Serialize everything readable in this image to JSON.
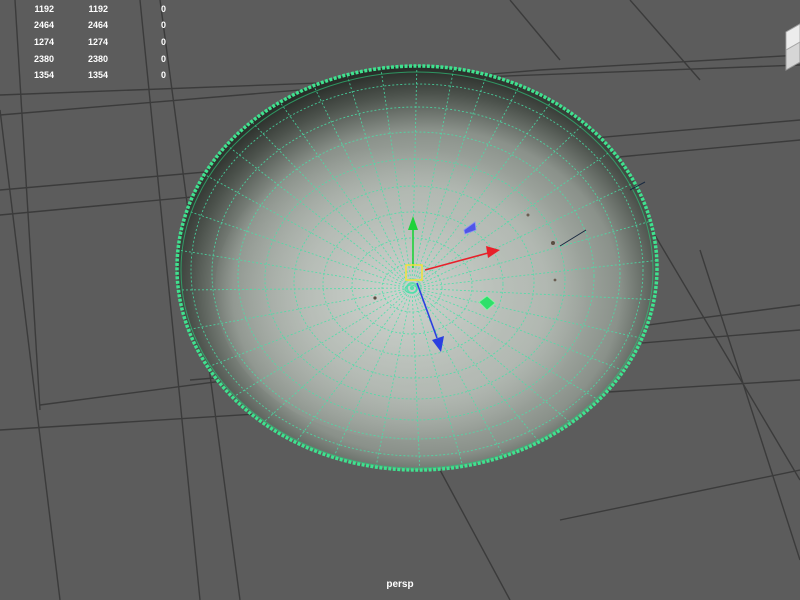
{
  "viewport": {
    "camera_label": "persp",
    "background_color": "#5c5c5c",
    "grid_color": "#3a3a3a",
    "wireframe_color": "#48e0a8",
    "selection_outline_color": "#3fe28f"
  },
  "hud_stats": {
    "rows": [
      {
        "c1": "1192",
        "c2": "1192",
        "c3": "0"
      },
      {
        "c1": "2464",
        "c2": "2464",
        "c3": "0"
      },
      {
        "c1": "1274",
        "c2": "1274",
        "c3": "0"
      },
      {
        "c1": "2380",
        "c2": "2380",
        "c3": "0"
      },
      {
        "c1": "1354",
        "c2": "1354",
        "c3": "0"
      }
    ]
  },
  "manipulator": {
    "x_axis_color": "#e8202a",
    "y_axis_color": "#1fd23a",
    "z_axis_color": "#2b3fe0",
    "center_box_color": "#f2e23a",
    "plane_handles": [
      "xz-plane-handle",
      "yz-plane-handle"
    ]
  },
  "icons": {
    "view_cube": "view-cube-icon",
    "move_tool": "move-manipulator-icon"
  }
}
